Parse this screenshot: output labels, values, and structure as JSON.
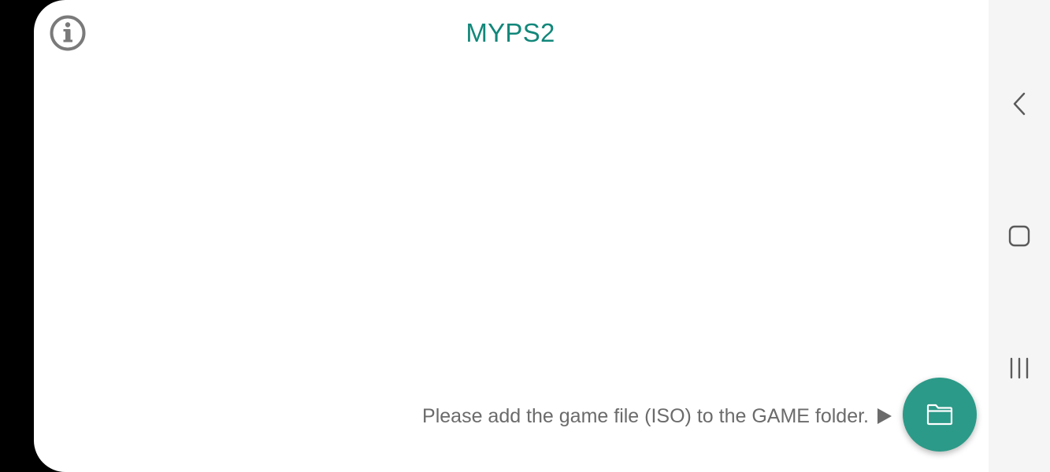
{
  "app": {
    "title": "MYPS2",
    "accent_color": "#12877a",
    "fab_color": "#2c9a88",
    "info_icon": "info-icon",
    "hint": {
      "text": "Please add the game file (ISO) to the GAME folder.",
      "arrow_icon": "play-arrow-icon"
    },
    "fab_icon": "folder-icon"
  },
  "navigation_bar": {
    "buttons": [
      {
        "name": "back",
        "icon": "back-chevron-icon"
      },
      {
        "name": "home",
        "icon": "home-square-icon"
      },
      {
        "name": "recents",
        "icon": "recents-lines-icon"
      }
    ]
  }
}
